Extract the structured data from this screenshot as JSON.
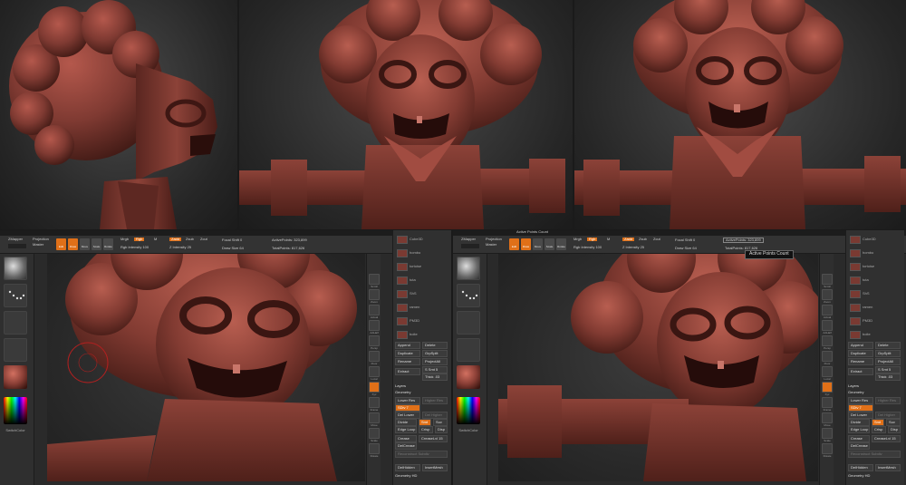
{
  "colors": {
    "clay": "#8a3f36",
    "clay_dark": "#4e1e19",
    "accent": "#e07018",
    "ui_bg": "#2a2a2a"
  },
  "left_window": {
    "title": "",
    "toolbar": {
      "zmapper": "ZMapper",
      "projection_master": "Projection",
      "projection_master_2": "Master",
      "mode_buttons": [
        "Edit",
        "Draw",
        "Move",
        "Scale",
        "Rotate"
      ],
      "mrgb": "Mrgb",
      "rgb": "Rgb",
      "m": "M",
      "zadd": "Zadd",
      "zsub": "Zsub",
      "zcut": "Zcut",
      "rgb_intensity": "Rgb Intensity 100",
      "z_intensity": "Z Intensity 25",
      "focal_shift": "Focal Shift 0",
      "draw_size": "Draw Size 64",
      "active_points": "ActivePoints: 323,899",
      "total_points": "TotalPoints: 817,626"
    },
    "left_tray": {
      "switch_color": "SwitchColor"
    },
    "shelf": [
      "Scroll",
      "Zoom",
      "Actual",
      "AAHalf",
      "Persp",
      "Floor",
      "Local",
      "Xyz",
      "Frame",
      "Move",
      "Scale",
      "Rotate",
      "Transp",
      "Ghost",
      "Solo"
    ],
    "tool_list": [
      "Cube3D",
      "hombo",
      "tortoise",
      "tuta",
      "ShS",
      "ramen",
      "PM3D",
      "boite"
    ],
    "subtool": {
      "append": "Append",
      "delete": "Delete",
      "duplicate": "Duplicate",
      "group_split": "GrpSplit",
      "rename": "Rename",
      "project_all": "ProjectAll",
      "extract": "Extract",
      "s_smt": "S Smt 5",
      "thick": "Thick .03"
    },
    "layers": "Layers",
    "geometry": {
      "title": "Geometry",
      "lower_res": "Lower Res",
      "higher_res": "Higher Res",
      "sdiv": "SDiv 7",
      "del_lower": "Del Lower",
      "del_higher": "Del Higher",
      "divide": "Divide",
      "smt": "Smt",
      "suv": "Suv",
      "edge_loop": "Edge Loop",
      "crisp": "Crisp",
      "disp": "Disp",
      "crease": "Crease",
      "crease_lvl": "CreaseLvl 15",
      "del_crease": "DelCrease",
      "reconstruct": "Reconstruct Subdiv",
      "del_hidden": "DelHidden",
      "insert_mesh": "InsertMesh"
    },
    "geometry_hd": "Geometry HD"
  },
  "right_window": {
    "title": "Active Points Count",
    "tooltip": "Active Points Count"
  }
}
